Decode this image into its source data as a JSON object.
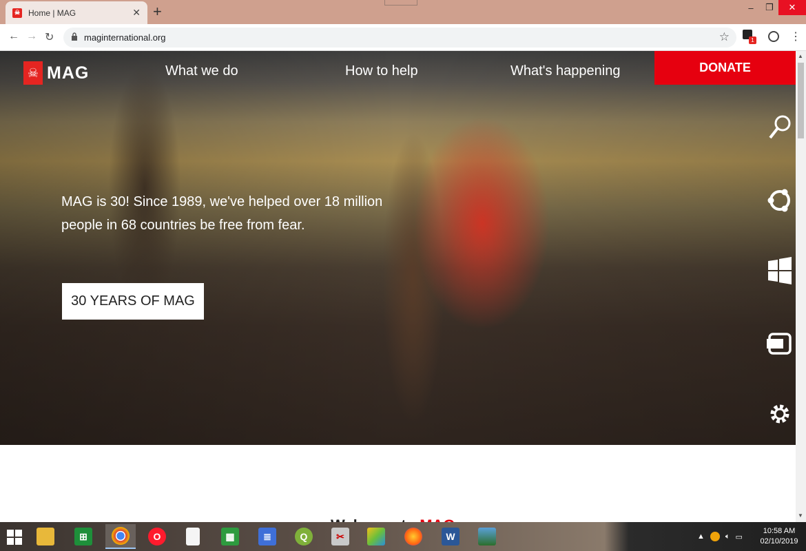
{
  "browser": {
    "tab_title": "Home | MAG",
    "url": "maginternational.org",
    "extension_badge": "1",
    "window_controls": {
      "minimize": "–",
      "maximize": "❐",
      "close": "✕"
    }
  },
  "site": {
    "logo_text": "MAG",
    "nav": [
      {
        "label": "What we do"
      },
      {
        "label": "How to help"
      },
      {
        "label": "What's happening"
      }
    ],
    "donate_label": "DONATE",
    "hero_headline": "MAG is 30! Since 1989, we've helped over 18 million people in 68 countries be free from fear.",
    "cta_label": "30 YEARS OF MAG",
    "welcome_prefix": "Welcome to ",
    "welcome_brand": "MAG"
  },
  "side_toolbar": [
    "search-icon",
    "ubuntu-icon",
    "windows-icon",
    "switch-icon",
    "settings-icon"
  ],
  "taskbar": {
    "apps": [
      "file-explorer-icon",
      "store-icon",
      "chrome-icon",
      "opera-icon",
      "blank-doc-icon",
      "calculator-icon",
      "notepad-icon",
      "qgis-icon",
      "tool-icon",
      "bluestacks-icon",
      "firefox-icon",
      "word-icon",
      "photo-icon"
    ],
    "time": "10:58 AM",
    "date": "02/10/2019"
  },
  "colors": {
    "brand_red": "#e6000f",
    "tab_strip": "#cfa08e"
  }
}
